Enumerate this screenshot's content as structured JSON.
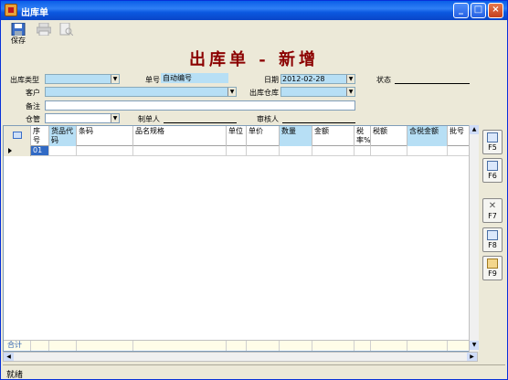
{
  "window": {
    "title": "出库单"
  },
  "toolbar": {
    "save_label": "保存",
    "print_label": "打印",
    "preview_label": "预览"
  },
  "form": {
    "heading": "出库单 - 新增",
    "type_label": "出库类型",
    "no_label": "单号",
    "no_value": "自动编号",
    "date_label": "日期",
    "date_value": "2012-02-28",
    "status_label": "状态",
    "customer_label": "客户",
    "warehouse_label": "出库仓库",
    "remark_label": "备注",
    "store_label": "仓管",
    "creator_label": "制单人",
    "auditor_label": "审核人"
  },
  "grid": {
    "columns": [
      "序号",
      "货品代码",
      "条码",
      "品名规格",
      "单位",
      "单价",
      "数量",
      "金额",
      "税率%",
      "税额",
      "含税金额",
      "批号"
    ],
    "rows": [
      [
        "01",
        "",
        "",
        "",
        "",
        "",
        "",
        "",
        "",
        "",
        "",
        ""
      ]
    ],
    "footer_label": "合计"
  },
  "sidebar": {
    "keys": [
      "F5",
      "F6",
      "F7",
      "F8",
      "F9"
    ]
  },
  "status": {
    "text": "就绪"
  }
}
